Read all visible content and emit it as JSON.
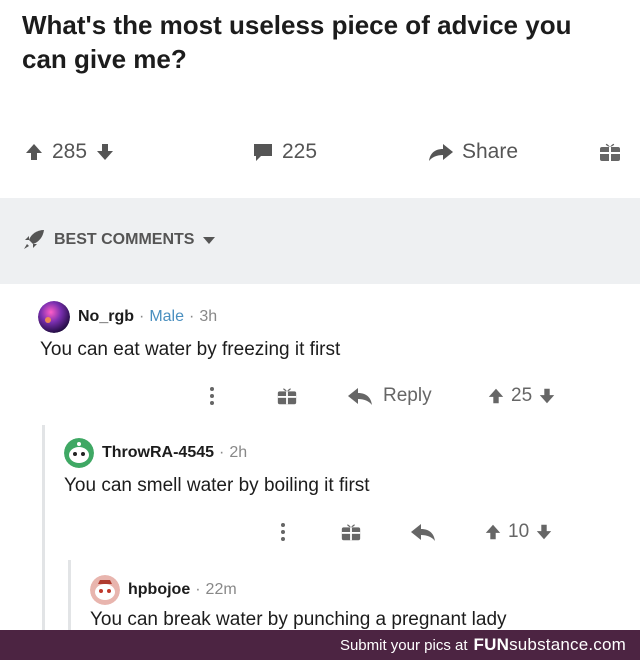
{
  "post": {
    "title": "What's the most useless piece of advice you can give me?",
    "votes": "285",
    "comments": "225",
    "share_label": "Share"
  },
  "sort": {
    "label": "BEST COMMENTS"
  },
  "comments": [
    {
      "username": "No_rgb",
      "flair": "Male",
      "age": "3h",
      "body": "You can eat water by freezing it first",
      "reply_label": "Reply",
      "votes": "25"
    },
    {
      "username": "ThrowRA-4545",
      "age": "2h",
      "body": "You can smell water by boiling it first",
      "votes": "10"
    },
    {
      "username": "hpbojoe",
      "age": "22m",
      "body": "You can break water by punching a pregnant lady"
    }
  ],
  "footer": {
    "text": "Submit your pics at",
    "brand_bold": "FUN",
    "brand_rest": "substance.com"
  },
  "colors": {
    "footer_bg": "#4c2442",
    "flair": "#4a8fbf",
    "section_bg": "#eef0f2"
  }
}
